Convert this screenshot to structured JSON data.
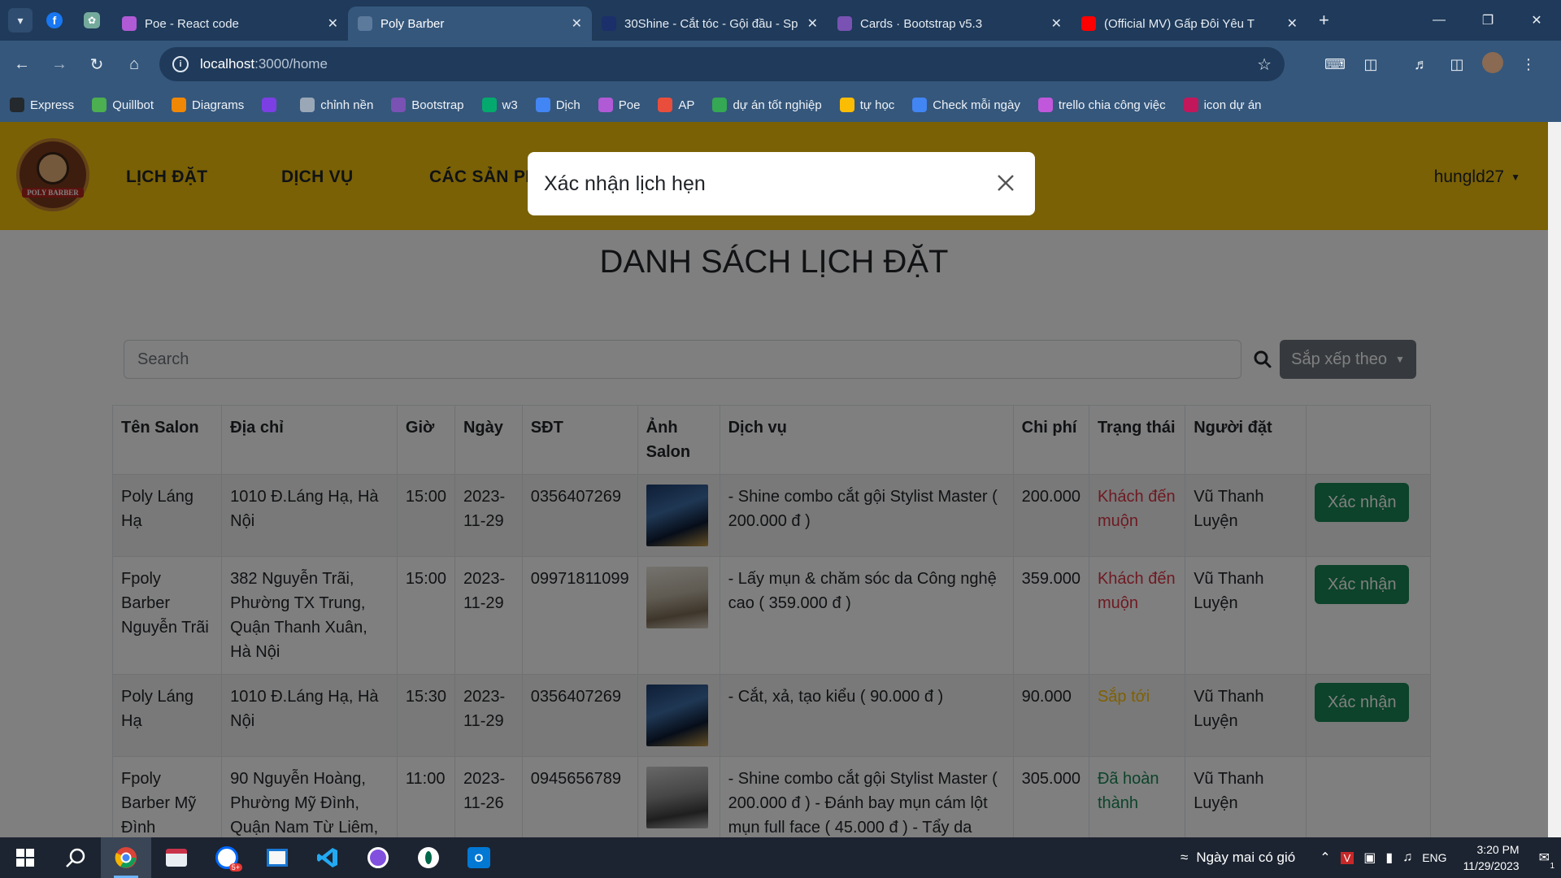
{
  "browser": {
    "tabs": [
      {
        "title": "Poe - React code",
        "active": false,
        "fav_color": "#b15ad6",
        "fav_icon": "poe-icon"
      },
      {
        "title": "Poly Barber",
        "active": true,
        "fav_color": "#5c7a9c",
        "fav_icon": "globe-icon"
      },
      {
        "title": "30Shine - Cắt tóc - Gội đầu - Sp",
        "active": false,
        "fav_color": "#1b2f6b",
        "fav_icon": "30shine-icon"
      },
      {
        "title": "Cards · Bootstrap v5.3",
        "active": false,
        "fav_color": "#7952b3",
        "fav_icon": "bootstrap-icon"
      },
      {
        "title": "(Official MV) Gấp Đôi Yêu T",
        "active": false,
        "fav_color": "#ff0000",
        "fav_icon": "youtube-icon"
      }
    ],
    "url_host": "localhost",
    "url_path": ":3000/home",
    "bookmarks": [
      {
        "label": "Express",
        "color": "#24292e",
        "icon": "github-icon"
      },
      {
        "label": "Quillbot",
        "color": "#4caf50",
        "icon": "quillbot-icon"
      },
      {
        "label": "Diagrams",
        "color": "#f08705",
        "icon": "diagrams-icon"
      },
      {
        "label": "",
        "color": "#7b3fe4",
        "icon": "figma-dev-icon"
      },
      {
        "label": "chỉnh nền",
        "color": "#9aa7b6",
        "icon": "image-icon"
      },
      {
        "label": "Bootstrap",
        "color": "#7952b3",
        "icon": "bootstrap-icon"
      },
      {
        "label": "w3",
        "color": "#04aa6d",
        "icon": "w3-icon"
      },
      {
        "label": "Dịch",
        "color": "#4285f4",
        "icon": "translate-icon"
      },
      {
        "label": "Poe",
        "color": "#b15ad6",
        "icon": "poe-icon"
      },
      {
        "label": "AP",
        "color": "#e94e3c",
        "icon": "cloud-icon"
      },
      {
        "label": "dự án tốt nghiệp",
        "color": "#34a853",
        "icon": "drive-icon"
      },
      {
        "label": "tự học",
        "color": "#fbbc04",
        "icon": "drive-icon"
      },
      {
        "label": "Check mỗi ngày",
        "color": "#4285f4",
        "icon": "docs-icon"
      },
      {
        "label": "trello chia công việc",
        "color": "#c158dc",
        "icon": "trello-icon"
      },
      {
        "label": "icon dự án",
        "color": "#c2185b",
        "icon": "bookmark-icon"
      }
    ]
  },
  "site": {
    "logo_text": "POLY BARBER",
    "nav": [
      "LỊCH ĐẶT",
      "DỊCH VỤ",
      "CÁC SẢN PH"
    ],
    "user": "hungld27"
  },
  "page": {
    "title": "DANH SÁCH LỊCH ĐẶT",
    "search_placeholder": "Search",
    "sort_label": "Sắp xếp theo",
    "columns": [
      "Tên Salon",
      "Địa chỉ",
      "Giờ",
      "Ngày",
      "SĐT",
      "Ảnh Salon",
      "Dịch vụ",
      "Chi phí",
      "Trạng thái",
      "Người đặt",
      ""
    ],
    "rows": [
      {
        "salon": "Poly Láng Hạ",
        "address": "1010 Đ.Láng Hạ, Hà Nội",
        "time": "15:00",
        "date": "2023-11-29",
        "phone": "0356407269",
        "service": "- Shine combo cắt gội Stylist Master ( 200.000 đ )",
        "cost": "200.000",
        "status": "Khách đến muộn",
        "status_kind": "late",
        "booker": "Vũ Thanh Luyện",
        "action": "Xác nhận",
        "thumb": "salon-blue"
      },
      {
        "salon": "Fpoly Barber Nguyễn Trãi",
        "address": "382 Nguyễn Trãi, Phường TX Trung, Quận Thanh Xuân, Hà Nội",
        "time": "15:00",
        "date": "2023-11-29",
        "phone": "09971811099",
        "service": "- Lấy mụn & chăm sóc da Công nghệ cao ( 359.000 đ )",
        "cost": "359.000",
        "status": "Khách đến muộn",
        "status_kind": "late",
        "booker": "Vũ Thanh Luyện",
        "action": "Xác nhận",
        "thumb": "salon-white"
      },
      {
        "salon": "Poly Láng Hạ",
        "address": "1010 Đ.Láng Hạ, Hà Nội",
        "time": "15:30",
        "date": "2023-11-29",
        "phone": "0356407269",
        "service": "- Cắt, xả, tạo kiểu ( 90.000 đ )",
        "cost": "90.000",
        "status": "Sắp tới",
        "status_kind": "soon",
        "booker": "Vũ Thanh Luyện",
        "action": "Xác nhận",
        "thumb": "salon-blue"
      },
      {
        "salon": "Fpoly Barber Mỹ Đình",
        "address": "90 Nguyễn Hoàng, Phường Mỹ Đình, Quận Nam Từ Liêm,",
        "time": "11:00",
        "date": "2023-11-26",
        "phone": "0945656789",
        "service": "- Shine combo cắt gội Stylist Master ( 200.000 đ ) - Đánh bay mụn cám lột mụn full face ( 45.000 đ ) - Tẩy da chết",
        "cost": "305.000",
        "status": "Đã hoàn thành",
        "status_kind": "done",
        "booker": "Vũ Thanh Luyện",
        "action": "",
        "thumb": "salon-grey"
      }
    ]
  },
  "modal": {
    "title": "Xác nhận lịch hẹn"
  },
  "taskbar": {
    "weather": "Ngày mai có gió",
    "lang": "ENG",
    "time": "3:20 PM",
    "date": "11/29/2023",
    "notif_count": "1"
  },
  "colors": {
    "navbar": "#f4c20d",
    "confirm_button": "#198754",
    "status_late": "#dc3545",
    "status_soon": "#ffc107",
    "status_done": "#198754"
  }
}
